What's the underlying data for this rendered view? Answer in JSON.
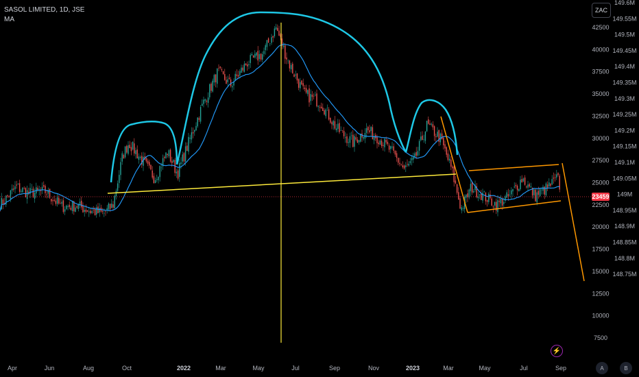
{
  "header": {
    "title": "SASOL LIMITED, 1D, JSE",
    "indicator": "MA"
  },
  "currency_button": "ZAC",
  "buttons": {
    "auto": "A",
    "log": "B"
  },
  "colors": {
    "background": "#000000",
    "candle_up": "#26a69a",
    "candle_down": "#ef5350",
    "ma_line": "#2196f3",
    "pattern_cyan": "#1ec8e6",
    "yellow_lines": "#ffeb3b",
    "orange_lines": "#ff9800",
    "last_price_label": "#f23645"
  },
  "chart_data": {
    "type": "candlestick",
    "title": "SASOL LIMITED, 1D, JSE",
    "indicators": [
      "MA"
    ],
    "x_ticks": [
      "Apr",
      "Jun",
      "Aug",
      "Oct",
      "2022",
      "Mar",
      "May",
      "Jul",
      "Sep",
      "Nov",
      "2023",
      "Mar",
      "May",
      "Jul",
      "Sep"
    ],
    "y_ticks_left": [
      42500,
      40000,
      37500,
      35000,
      32500,
      30000,
      27500,
      25000,
      22500,
      20000,
      17500,
      15000,
      12500,
      10000,
      7500
    ],
    "y_ticks_right": [
      "149.6M",
      "149.55M",
      "149.5M",
      "149.45M",
      "149.4M",
      "149.35M",
      "149.3M",
      "149.25M",
      "149.2M",
      "149.15M",
      "149.1M",
      "149.05M",
      "149M",
      "148.95M",
      "148.9M",
      "148.85M",
      "148.8M",
      "148.75M"
    ],
    "last_price": 23459,
    "price_path": [
      [
        "2021-03-25",
        22500
      ],
      [
        "2021-04-20",
        24500
      ],
      [
        "2021-05-10",
        23800
      ],
      [
        "2021-06-05",
        24000
      ],
      [
        "2021-06-30",
        22300
      ],
      [
        "2021-07-25",
        22400
      ],
      [
        "2021-08-15",
        21800
      ],
      [
        "2021-09-05",
        21500
      ],
      [
        "2021-09-20",
        22500
      ],
      [
        "2021-10-05",
        28000
      ],
      [
        "2021-10-15",
        29500
      ],
      [
        "2021-11-05",
        27500
      ],
      [
        "2021-11-25",
        25500
      ],
      [
        "2021-12-15",
        28500
      ],
      [
        "2021-12-31",
        26000
      ],
      [
        "2022-01-20",
        30000
      ],
      [
        "2022-02-10",
        34000
      ],
      [
        "2022-03-05",
        37500
      ],
      [
        "2022-03-25",
        36000
      ],
      [
        "2022-04-20",
        38500
      ],
      [
        "2022-05-15",
        39500
      ],
      [
        "2022-06-05",
        42500
      ],
      [
        "2022-06-25",
        38500
      ],
      [
        "2022-07-20",
        35000
      ],
      [
        "2022-08-15",
        34000
      ],
      [
        "2022-09-10",
        31000
      ],
      [
        "2022-10-05",
        29500
      ],
      [
        "2022-10-25",
        31000
      ],
      [
        "2022-11-15",
        30000
      ],
      [
        "2022-12-05",
        28500
      ],
      [
        "2022-12-25",
        26500
      ],
      [
        "2023-01-10",
        27500
      ],
      [
        "2023-01-30",
        31500
      ],
      [
        "2023-02-20",
        30000
      ],
      [
        "2023-03-10",
        26500
      ],
      [
        "2023-03-25",
        22000
      ],
      [
        "2023-04-10",
        24500
      ],
      [
        "2023-04-30",
        23500
      ],
      [
        "2023-05-20",
        22500
      ],
      [
        "2023-06-10",
        23500
      ],
      [
        "2023-06-30",
        25500
      ],
      [
        "2023-07-20",
        23500
      ],
      [
        "2023-08-10",
        24500
      ],
      [
        "2023-08-25",
        25500
      ],
      [
        "2023-09-01",
        23459
      ]
    ],
    "annotations": [
      {
        "type": "neckline",
        "color": "yellow",
        "points": [
          [
            "2021-08-20",
            22800
          ],
          [
            "2023-03-15",
            26000
          ]
        ]
      },
      {
        "type": "vertical_line",
        "color": "yellow",
        "from": [
          "2022-06-10",
          43500
        ],
        "to": [
          "2022-06-10",
          7000
        ]
      },
      {
        "type": "channel",
        "color": "orange",
        "upper": [
          [
            "2023-04-05",
            26200
          ],
          [
            "2023-09-01",
            27200
          ]
        ],
        "lower": [
          [
            "2023-04-05",
            21500
          ],
          [
            "2023-09-01",
            23000
          ]
        ]
      },
      {
        "type": "projection",
        "color": "orange",
        "points": [
          [
            "2023-09-01",
            27300
          ],
          [
            "2023-10-05",
            14000
          ]
        ]
      },
      {
        "type": "pattern_curves",
        "color": "cyan",
        "shape": "inverted head and shoulders (left shoulder, head, right shoulder)"
      }
    ],
    "grid": false
  }
}
